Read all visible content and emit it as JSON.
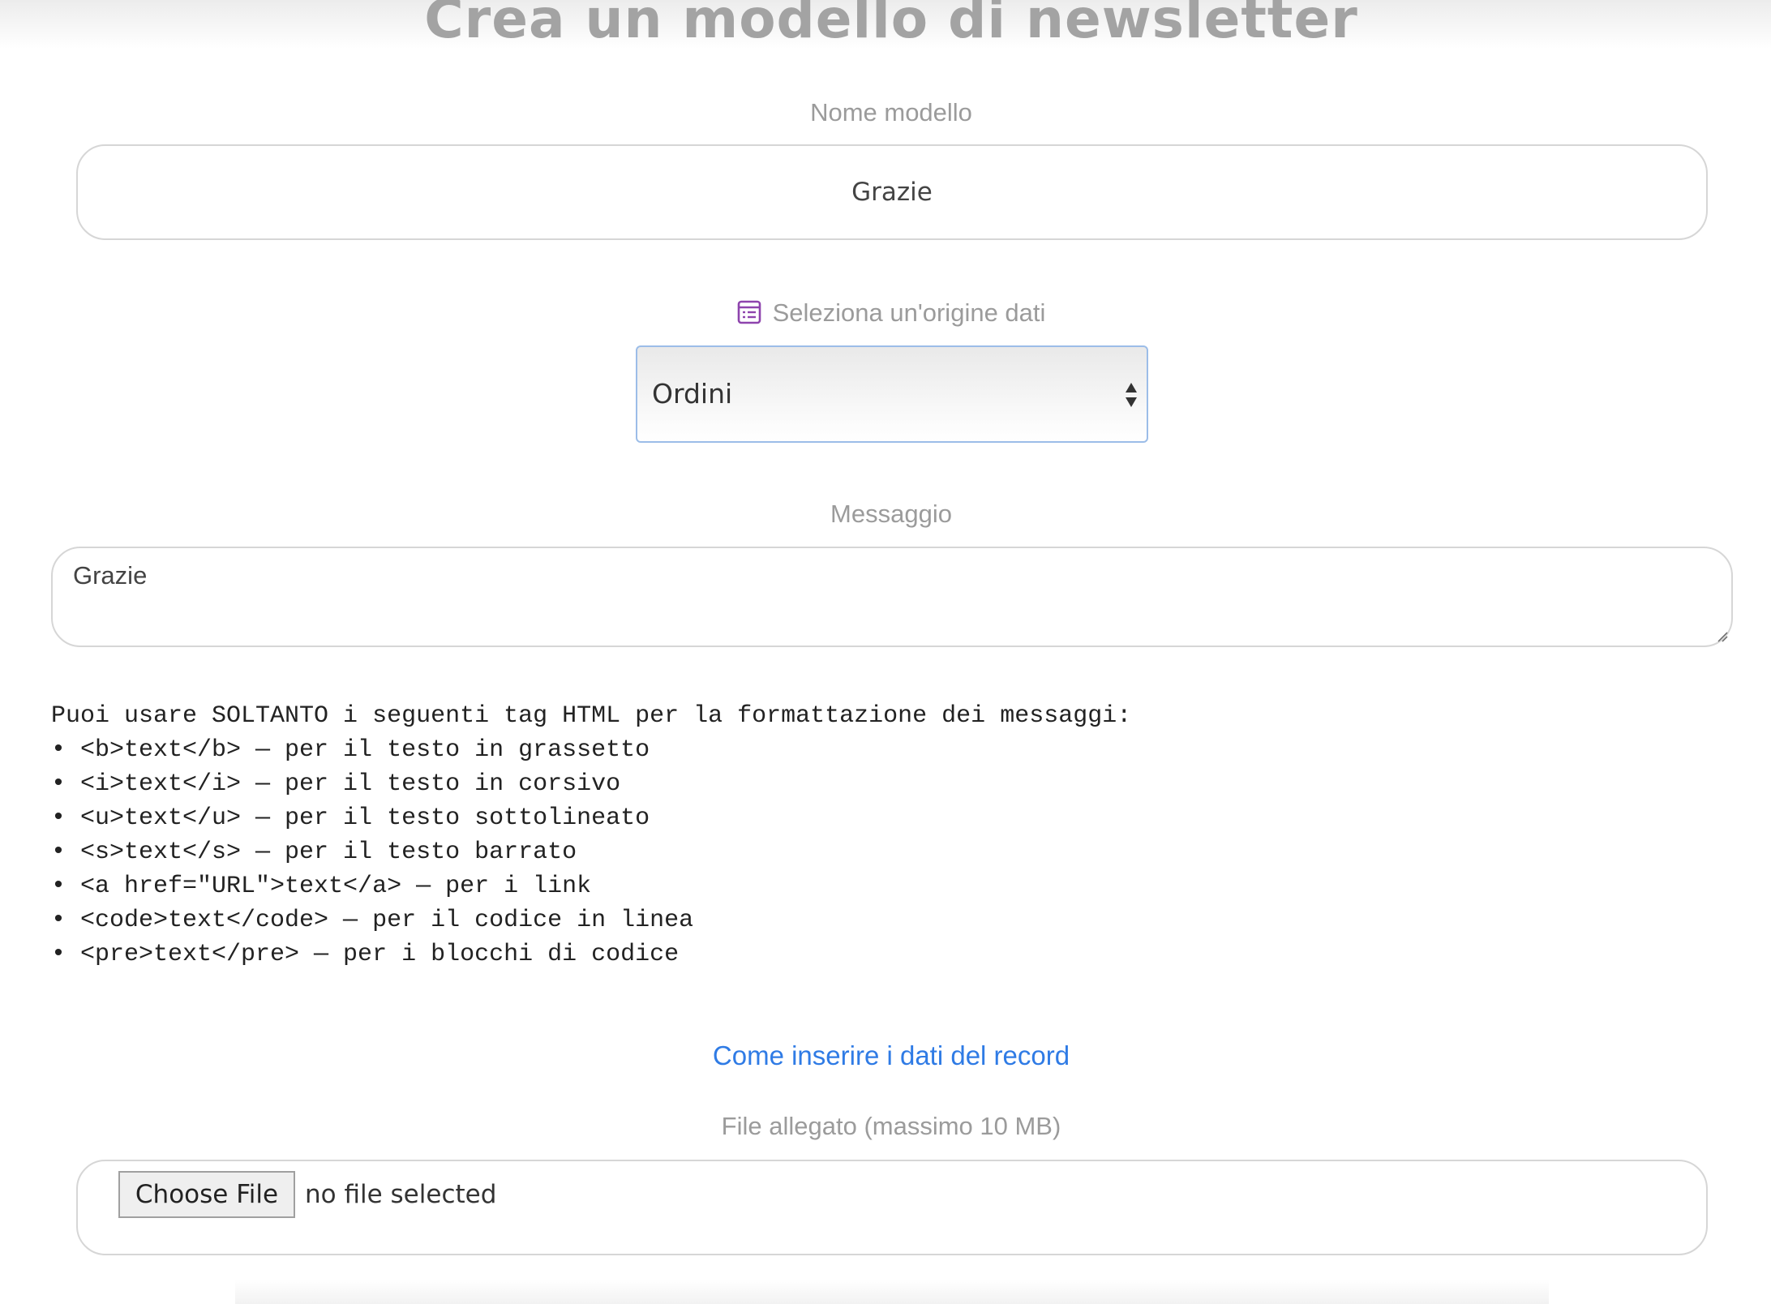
{
  "page": {
    "title": "Crea un modello di newsletter"
  },
  "template_name": {
    "label": "Nome modello",
    "value": "Grazie"
  },
  "data_source": {
    "label": "Seleziona un'origine dati",
    "icon": "table-list-icon",
    "icon_color": "#8e44ad",
    "selected": "Ordini"
  },
  "message": {
    "label": "Messaggio",
    "value": "Grazie"
  },
  "help": {
    "intro": "Puoi usare SOLTANTO i seguenti tag HTML per la formattazione dei messaggi:",
    "items": [
      "• <b>text</b> — per il testo in grassetto",
      "• <i>text</i> — per il testo in corsivo",
      "• <u>text</u> — per il testo sottolineato",
      "• <s>text</s> — per il testo barrato",
      "• <a href=\"URL\">text</a> — per i link",
      "• <code>text</code> — per il codice in linea",
      "• <pre>text</pre> — per i blocchi di codice"
    ]
  },
  "record_link": {
    "label": "Come inserire i dati del record",
    "color": "#2f7be5"
  },
  "attachment": {
    "label": "File allegato (massimo 10 MB)",
    "button_label": "Choose File",
    "status": "no file selected"
  }
}
